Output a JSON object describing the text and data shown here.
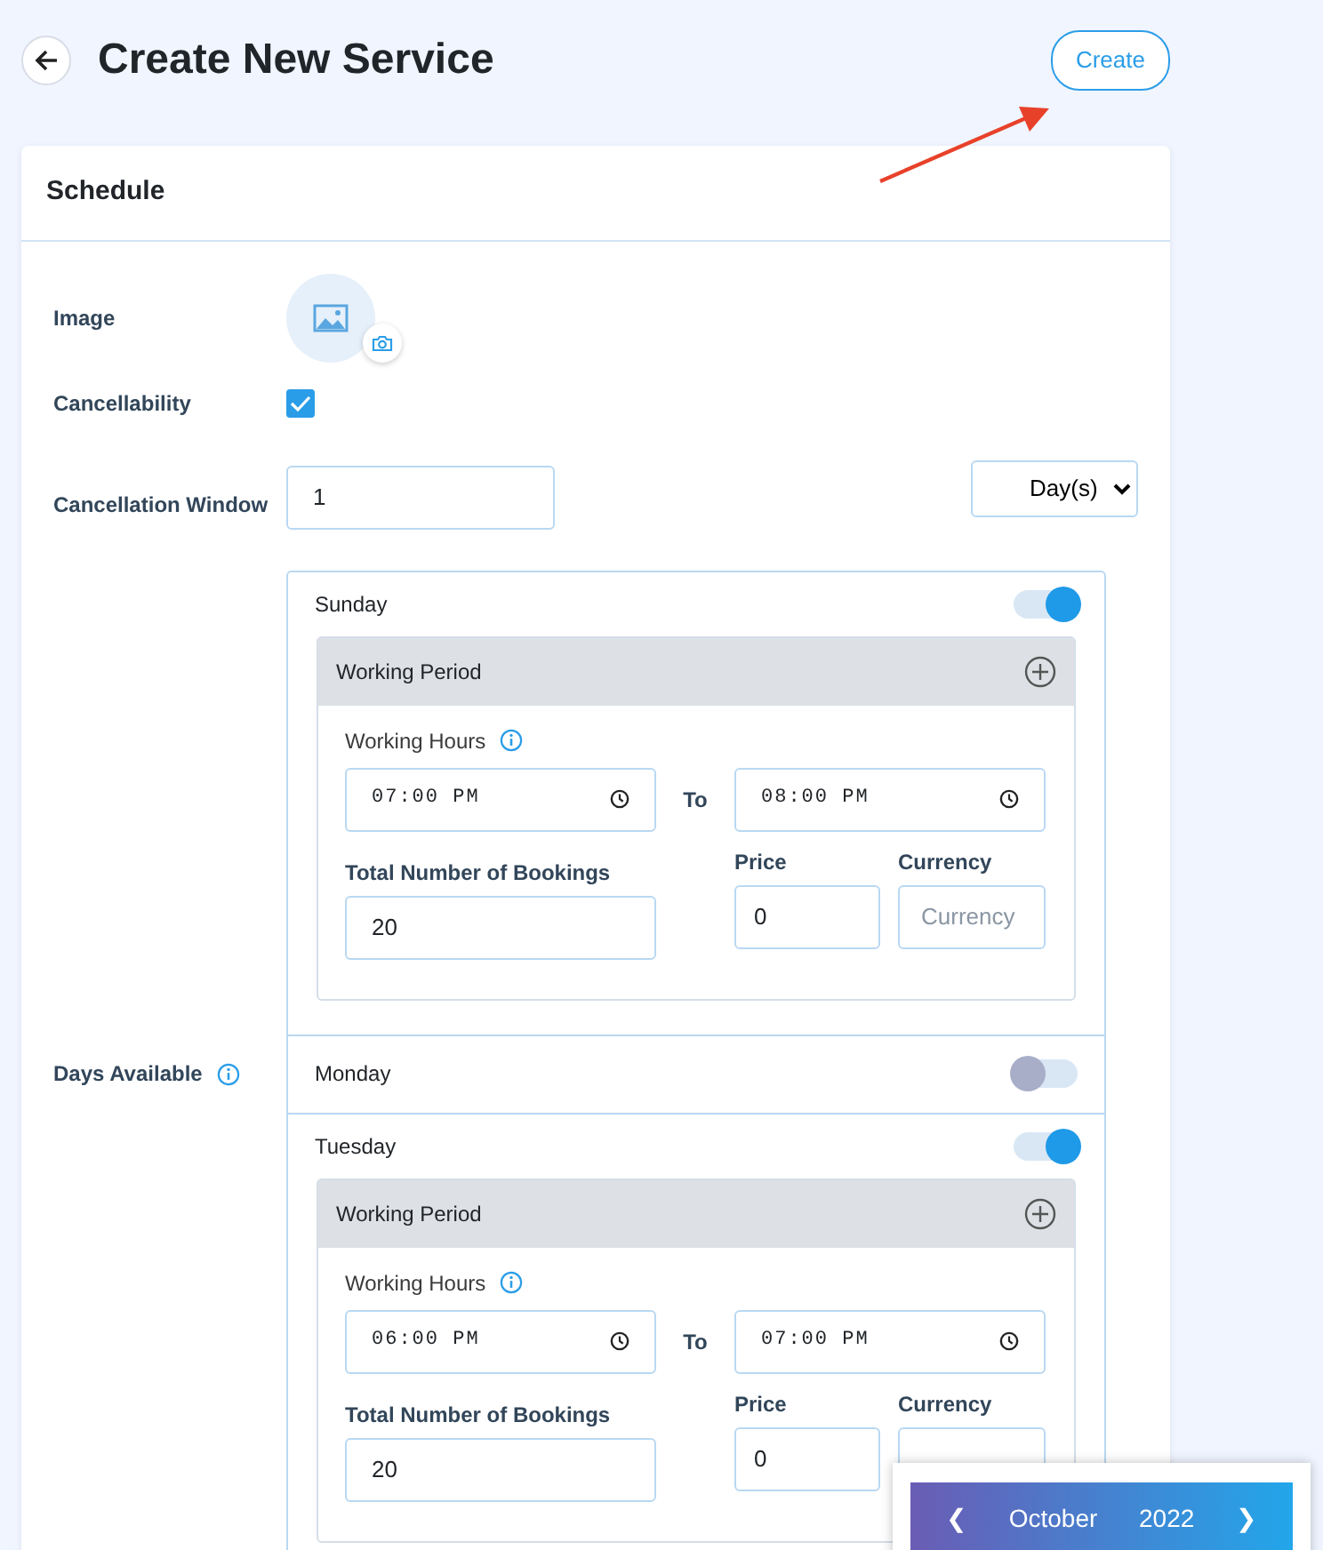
{
  "page_title": "Create New Service",
  "create_button": "Create",
  "card": {
    "title": "Schedule",
    "fields": [
      {
        "kind": "image",
        "label": "Image"
      },
      {
        "kind": "checkbox",
        "label": "Cancellability",
        "checked": true
      },
      {
        "kind": "amount",
        "label": "Cancellation Window",
        "value": "1",
        "unit": "Day(s)"
      }
    ],
    "days_label": "Days Available",
    "days": [
      {
        "name": "Sunday",
        "on": true,
        "periods": [
          {
            "title": "Working Period",
            "hours_label": "Working Hours",
            "from": "07:00 PM",
            "to_label": "To",
            "to": "08:00 PM",
            "bookings_label": "Total Number of Bookings",
            "bookings": "20",
            "price_label": "Price",
            "price": "0",
            "currency_label": "Currency",
            "currency_placeholder": "Currency"
          }
        ]
      },
      {
        "name": "Monday",
        "on": false
      },
      {
        "name": "Tuesday",
        "on": true,
        "periods": [
          {
            "title": "Working Period",
            "hours_label": "Working Hours",
            "from": "06:00 PM",
            "to_label": "To",
            "to": "07:00 PM",
            "bookings_label": "Total Number of Bookings",
            "bookings": "20",
            "price_label": "Price",
            "price": "0",
            "currency_label": "Currency"
          }
        ]
      }
    ]
  },
  "calendar_popup": {
    "prev": "❮",
    "month": "October",
    "year": "2022",
    "next": "❯"
  }
}
